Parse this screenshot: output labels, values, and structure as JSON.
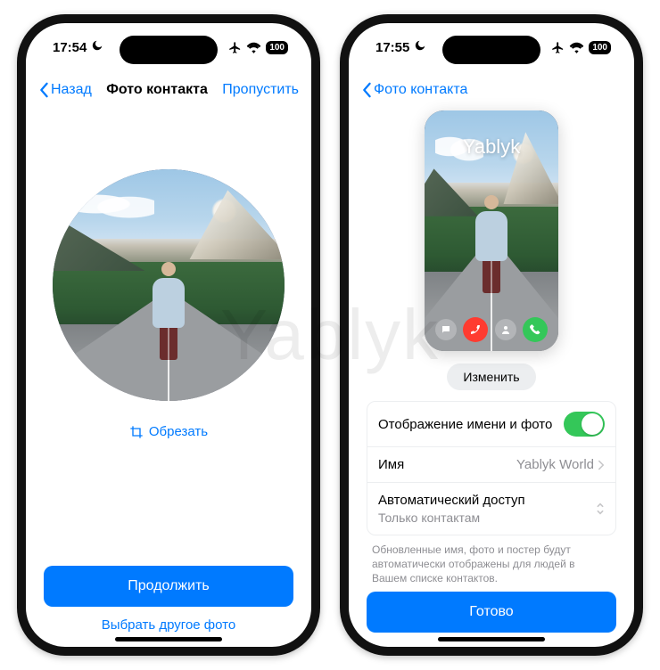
{
  "watermark": "Yablyk",
  "left": {
    "status": {
      "time": "17:54",
      "battery": "100"
    },
    "nav": {
      "back": "Назад",
      "title": "Фото контакта",
      "skip": "Пропустить"
    },
    "crop": "Обрезать",
    "continue": "Продолжить",
    "choose_other": "Выбрать другое фото"
  },
  "right": {
    "status": {
      "time": "17:55",
      "battery": "100"
    },
    "nav": {
      "back": "Фото контакта"
    },
    "poster_name": "Yablyk",
    "edit": "Изменить",
    "cells": {
      "share_label": "Отображение имени и фото",
      "share_on": true,
      "name_label": "Имя",
      "name_value": "Yablyk World",
      "auto_label": "Автоматический доступ",
      "auto_value": "Только контактам"
    },
    "footnote": "Обновленные имя, фото и постер будут автоматически отображены для людей в Вашем списке контактов.",
    "done": "Готово"
  }
}
